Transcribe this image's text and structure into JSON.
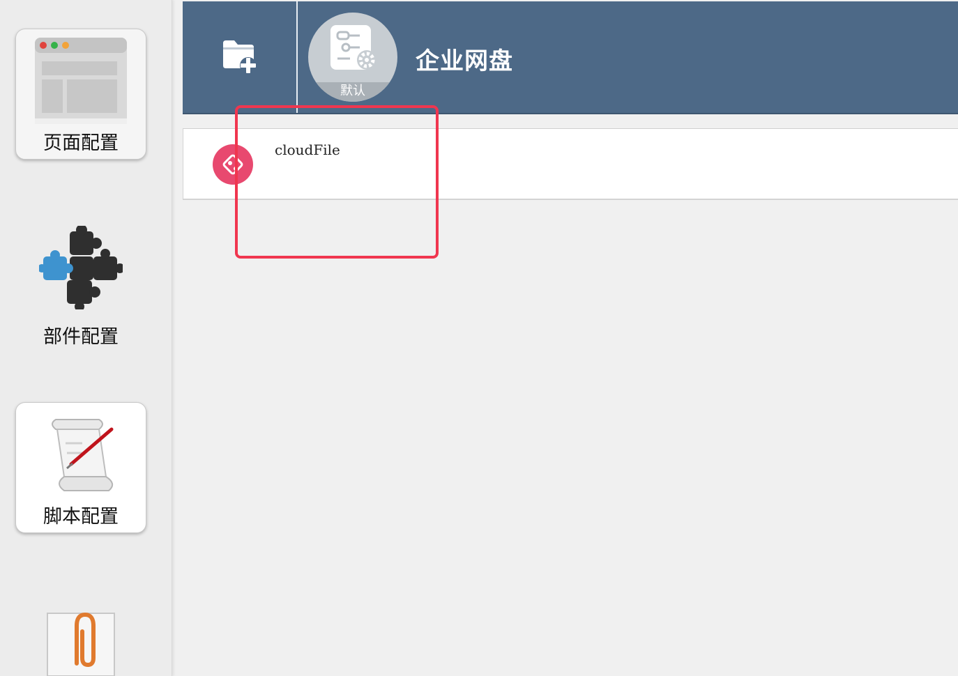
{
  "sidebar": {
    "items": [
      {
        "label": "页面配置",
        "icon": "page-layout-icon"
      },
      {
        "label": "部件配置",
        "icon": "puzzle-icon"
      },
      {
        "label": "脚本配置",
        "icon": "script-scroll-icon"
      },
      {
        "label": "",
        "icon": "paperclip-icon"
      }
    ]
  },
  "header": {
    "new_folder_icon": "folder-add-icon",
    "avatar_badge": "默认",
    "avatar_icon": "settings-document-icon",
    "title": "企业网盘"
  },
  "list": {
    "rows": [
      {
        "name": "cloudFile",
        "icon": "git-icon"
      }
    ]
  },
  "colors": {
    "header_bg": "#4d6987",
    "row_icon": "#e8496f",
    "highlight": "#f0364f"
  }
}
